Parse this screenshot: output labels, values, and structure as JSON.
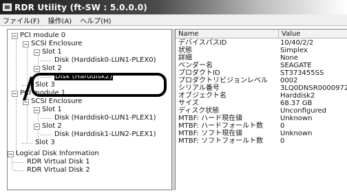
{
  "window": {
    "title": "RDR Utility (ft-SW : 5.0.0.0)"
  },
  "menu": [
    {
      "label": "ファイル(F)"
    },
    {
      "label": "操作(A)"
    },
    {
      "label": "ヘルプ(H)"
    }
  ],
  "tree": [
    {
      "label": "PCI module 0",
      "expander": "−"
    },
    {
      "label": "SCSI Enclosure",
      "expander": "−"
    },
    {
      "label": "Slot 1",
      "expander": "−"
    },
    {
      "label": "Disk (Harddisk0-LUN1-PLEX0)",
      "expander": ""
    },
    {
      "label": "Slot 2",
      "expander": "−"
    },
    {
      "label": "Disk (Harddisk2)",
      "expander": "",
      "selected": true
    },
    {
      "label": "Slot 3",
      "expander": ""
    },
    {
      "label": "PCI module 1",
      "expander": "−"
    },
    {
      "label": "SCSI Enclosure",
      "expander": "−"
    },
    {
      "label": "Slot 1",
      "expander": "−"
    },
    {
      "label": "Disk (Harddisk0-LUN1-PLEX1)",
      "expander": ""
    },
    {
      "label": "Slot 2",
      "expander": "−"
    },
    {
      "label": "Disk (Harddisk1-LUN2-PLEX1)",
      "expander": ""
    },
    {
      "label": "Slot 3",
      "expander": ""
    },
    {
      "label": "Logical Disk Information",
      "expander": "−"
    },
    {
      "label": "RDR Virtual Disk 1",
      "expander": ""
    },
    {
      "label": "RDR Virtual Disk 2",
      "expander": ""
    }
  ],
  "list": {
    "headers": {
      "name": "Name",
      "value": "Value"
    },
    "rows": [
      {
        "name": "デバイスパスID",
        "value": "10/40/2/2"
      },
      {
        "name": "状態",
        "value": "Simplex"
      },
      {
        "name": "詳細",
        "value": "None"
      },
      {
        "name": "ベンダー名",
        "value": "SEAGATE"
      },
      {
        "name": "プロダクトID",
        "value": "ST373455SS"
      },
      {
        "name": "プロダクトリビジョンレベル",
        "value": "0002"
      },
      {
        "name": "シリアル番号",
        "value": "3LQ0DNSR0000972"
      },
      {
        "name": "オブジェクト名",
        "value": "Harddisk2"
      },
      {
        "name": "サイズ",
        "value": "68.37 GB"
      },
      {
        "name": "ディスク状態",
        "value": "Unconfigured"
      },
      {
        "name": "MTBF: ハード現在値",
        "value": "Unknown"
      },
      {
        "name": "MTBF: ハードフォールト数",
        "value": "0"
      },
      {
        "name": "MTBF: ソフト現在値",
        "value": "Unknown"
      },
      {
        "name": "MTBF: ソフトフォールト数",
        "value": "0"
      }
    ]
  }
}
